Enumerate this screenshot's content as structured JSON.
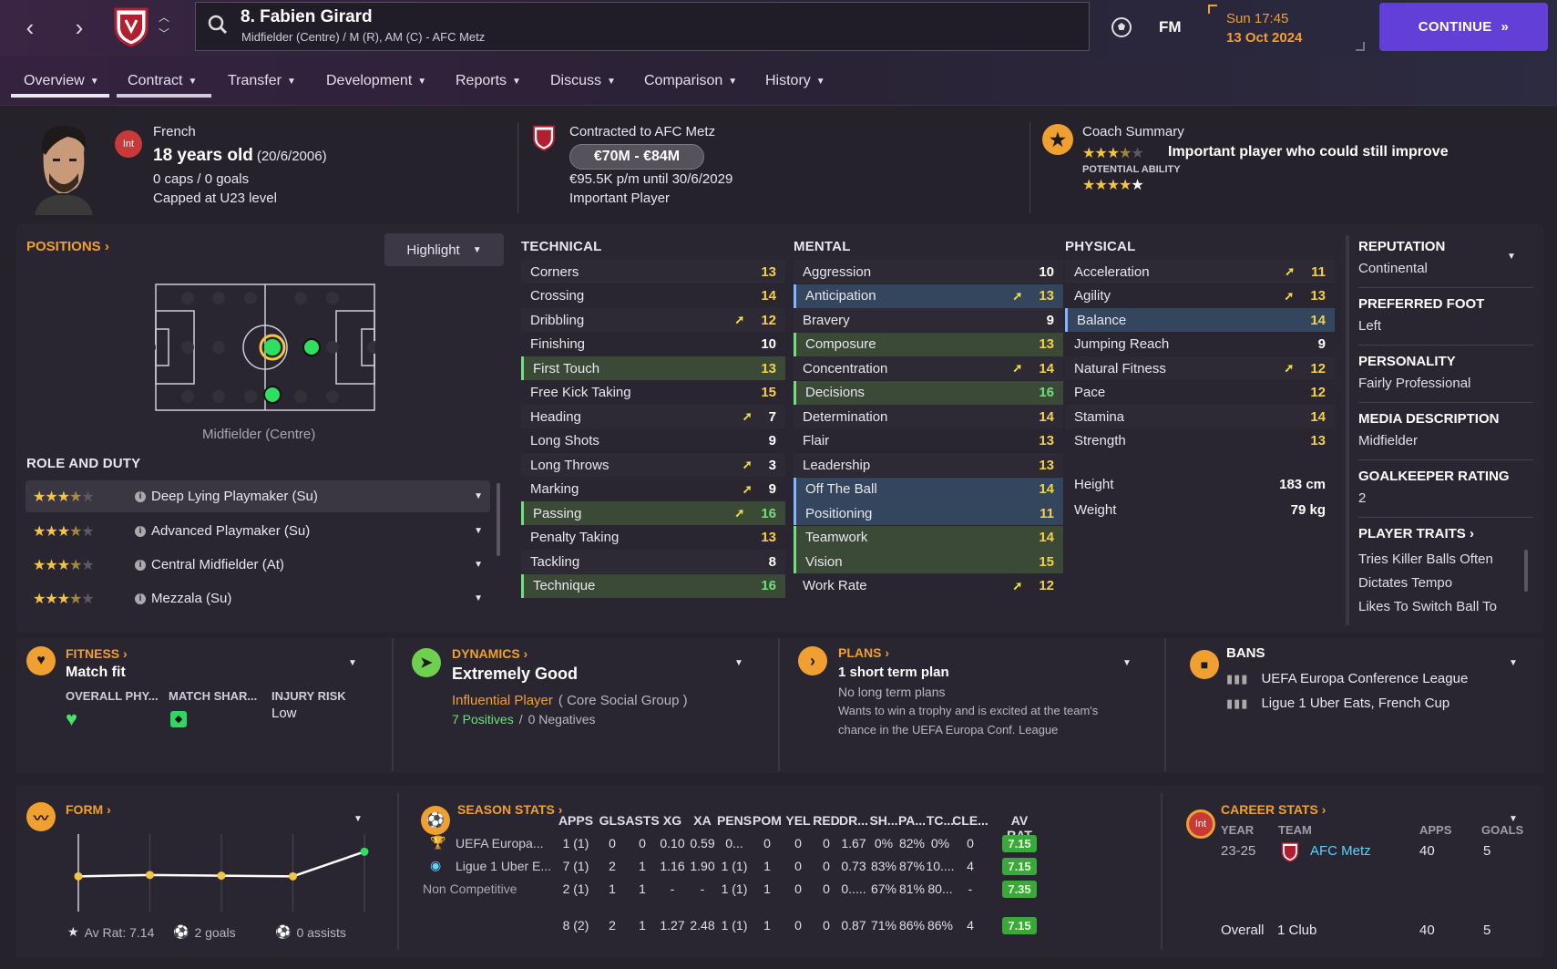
{
  "header": {
    "player_name": "8. Fabien Girard",
    "player_subtitle": "Midfielder (Centre) / M (R), AM (C) - AFC Metz",
    "brand": "FM",
    "time": "Sun 17:45",
    "date": "13 Oct 2024",
    "continue_label": "CONTINUE",
    "accent": "#6240d8"
  },
  "tabs": [
    {
      "label": "Overview",
      "active": true
    },
    {
      "label": "Contract",
      "active": false
    },
    {
      "label": "Transfer"
    },
    {
      "label": "Development"
    },
    {
      "label": "Reports"
    },
    {
      "label": "Discuss"
    },
    {
      "label": "Comparison"
    },
    {
      "label": "History"
    }
  ],
  "profile": {
    "nationality_badge": "Int",
    "nationality": "French",
    "age": "18 years old",
    "dob": "(20/6/2006)",
    "caps": "0 caps / 0 goals",
    "capped_level": "Capped at U23 level",
    "contracted_to": "Contracted to AFC Metz",
    "value": "€70M - €84M",
    "wage": "€95.5K p/m until 30/6/2029",
    "squad_status": "Important Player",
    "coach_summary_title": "Coach Summary",
    "coach_summary": "Important player who could still improve",
    "current_ability_stars": 3.5,
    "potential_label": "POTENTIAL ABILITY",
    "potential_ability_stars": 4.5
  },
  "positions": {
    "title": "POSITIONS",
    "highlight_label": "Highlight",
    "caption": "Midfielder (Centre)"
  },
  "roles": {
    "title": "ROLE AND DUTY",
    "items": [
      {
        "name": "Deep Lying Playmaker (Su)",
        "stars": 3.5
      },
      {
        "name": "Advanced Playmaker (Su)",
        "stars": 3.5
      },
      {
        "name": "Central Midfielder (At)",
        "stars": 3.5
      },
      {
        "name": "Mezzala (Su)",
        "stars": 3.5
      }
    ]
  },
  "attributes": {
    "technical_title": "TECHNICAL",
    "mental_title": "MENTAL",
    "physical_title": "PHYSICAL",
    "technical": [
      {
        "name": "Corners",
        "value": "13",
        "arrow": false,
        "hl": ""
      },
      {
        "name": "Crossing",
        "value": "14",
        "arrow": false,
        "hl": ""
      },
      {
        "name": "Dribbling",
        "value": "12",
        "arrow": true,
        "hl": ""
      },
      {
        "name": "Finishing",
        "value": "10",
        "arrow": false,
        "hl": ""
      },
      {
        "name": "First Touch",
        "value": "13",
        "arrow": false,
        "hl": "g"
      },
      {
        "name": "Free Kick Taking",
        "value": "15",
        "arrow": false,
        "hl": ""
      },
      {
        "name": "Heading",
        "value": "7",
        "arrow": true,
        "hl": ""
      },
      {
        "name": "Long Shots",
        "value": "9",
        "arrow": false,
        "hl": ""
      },
      {
        "name": "Long Throws",
        "value": "3",
        "arrow": true,
        "hl": ""
      },
      {
        "name": "Marking",
        "value": "9",
        "arrow": true,
        "hl": ""
      },
      {
        "name": "Passing",
        "value": "16",
        "arrow": true,
        "hl": "g"
      },
      {
        "name": "Penalty Taking",
        "value": "13",
        "arrow": false,
        "hl": ""
      },
      {
        "name": "Tackling",
        "value": "8",
        "arrow": false,
        "hl": ""
      },
      {
        "name": "Technique",
        "value": "16",
        "arrow": false,
        "hl": "g"
      }
    ],
    "mental": [
      {
        "name": "Aggression",
        "value": "10",
        "arrow": false,
        "hl": ""
      },
      {
        "name": "Anticipation",
        "value": "13",
        "arrow": true,
        "hl": "b"
      },
      {
        "name": "Bravery",
        "value": "9",
        "arrow": false,
        "hl": ""
      },
      {
        "name": "Composure",
        "value": "13",
        "arrow": false,
        "hl": "g"
      },
      {
        "name": "Concentration",
        "value": "14",
        "arrow": true,
        "hl": ""
      },
      {
        "name": "Decisions",
        "value": "16",
        "arrow": false,
        "hl": "g"
      },
      {
        "name": "Determination",
        "value": "14",
        "arrow": false,
        "hl": ""
      },
      {
        "name": "Flair",
        "value": "13",
        "arrow": false,
        "hl": ""
      },
      {
        "name": "Leadership",
        "value": "13",
        "arrow": false,
        "hl": ""
      },
      {
        "name": "Off The Ball",
        "value": "14",
        "arrow": false,
        "hl": "b"
      },
      {
        "name": "Positioning",
        "value": "11",
        "arrow": false,
        "hl": "b"
      },
      {
        "name": "Teamwork",
        "value": "14",
        "arrow": false,
        "hl": "g"
      },
      {
        "name": "Vision",
        "value": "15",
        "arrow": false,
        "hl": "g"
      },
      {
        "name": "Work Rate",
        "value": "12",
        "arrow": true,
        "hl": ""
      }
    ],
    "physical": [
      {
        "name": "Acceleration",
        "value": "11",
        "arrow": true,
        "hl": ""
      },
      {
        "name": "Agility",
        "value": "13",
        "arrow": true,
        "hl": ""
      },
      {
        "name": "Balance",
        "value": "14",
        "arrow": false,
        "hl": "b"
      },
      {
        "name": "Jumping Reach",
        "value": "9",
        "arrow": false,
        "hl": ""
      },
      {
        "name": "Natural Fitness",
        "value": "12",
        "arrow": true,
        "hl": ""
      },
      {
        "name": "Pace",
        "value": "12",
        "arrow": false,
        "hl": ""
      },
      {
        "name": "Stamina",
        "value": "14",
        "arrow": false,
        "hl": ""
      },
      {
        "name": "Strength",
        "value": "13",
        "arrow": false,
        "hl": ""
      }
    ],
    "height_label": "Height",
    "height": "183 cm",
    "weight_label": "Weight",
    "weight": "79 kg"
  },
  "side": {
    "reputation_h": "REPUTATION",
    "reputation": "Continental",
    "foot_h": "PREFERRED FOOT",
    "foot": "Left",
    "personality_h": "PERSONALITY",
    "personality": "Fairly Professional",
    "media_h": "MEDIA DESCRIPTION",
    "media": "Midfielder",
    "gk_h": "GOALKEEPER RATING",
    "gk": "2",
    "traits_h": "PLAYER TRAITS",
    "traits": [
      "Tries Killer Balls Often",
      "Dictates Tempo",
      "Likes To Switch Ball To"
    ]
  },
  "fitness": {
    "title": "FITNESS",
    "status": "Match fit",
    "col1": "OVERALL PHY...",
    "col2": "MATCH SHAR...",
    "col3": "INJURY RISK",
    "injury": "Low"
  },
  "dynamics": {
    "title": "DYNAMICS",
    "status": "Extremely Good",
    "role": "Influential Player",
    "group": "( Core Social Group )",
    "positives": "7 Positives",
    "sep": "/",
    "negatives": "0 Negatives"
  },
  "plans": {
    "title": "PLANS",
    "status": "1 short term plan",
    "line1": "No long term plans",
    "line2": "Wants to win a trophy and is excited at the team's",
    "line3": "chance in the UEFA Europa Conf. League"
  },
  "bans": {
    "title": "BANS",
    "items": [
      "UEFA Europa Conference League",
      "Ligue 1 Uber Eats, French Cup"
    ]
  },
  "form": {
    "title": "FORM",
    "ratings": [
      7.0,
      7.02,
      7.01,
      7.0,
      7.35
    ],
    "av_rat": "Av Rat: 7.14",
    "goals": "2 goals",
    "assists": "0 assists"
  },
  "season_stats": {
    "title": "SEASON STATS",
    "headers": [
      "APPS",
      "GLS",
      "ASTS",
      "XG",
      "XA",
      "PENS",
      "POM",
      "YEL",
      "RED",
      "DR...",
      "SH...",
      "PA...",
      "TC...",
      "CLE...",
      "AV RAT"
    ],
    "rows": [
      {
        "comp": "UEFA Europa...",
        "cells": [
          "1 (1)",
          "0",
          "0",
          "0.10",
          "0.59",
          "0...",
          "0",
          "0",
          "0",
          "1.67",
          "0%",
          "82%",
          "0%",
          "0",
          "7.15"
        ]
      },
      {
        "comp": "Ligue 1 Uber E...",
        "cells": [
          "7 (1)",
          "2",
          "1",
          "1.16",
          "1.90",
          "1 (1)",
          "1",
          "0",
          "0",
          "0.73",
          "83%",
          "87%",
          "10....",
          "4",
          "7.15"
        ]
      },
      {
        "comp": "Non Competitive",
        "cells": [
          "2 (1)",
          "1",
          "1",
          "-",
          "-",
          "1 (1)",
          "1",
          "0",
          "0",
          "0.....",
          "67%",
          "81%",
          "80...",
          "-",
          "7.35"
        ]
      }
    ],
    "total": [
      "8 (2)",
      "2",
      "1",
      "1.27",
      "2.48",
      "1 (1)",
      "1",
      "0",
      "0",
      "0.87",
      "71%",
      "86%",
      "86%",
      "4",
      "7.15"
    ]
  },
  "career_stats": {
    "title": "CAREER STATS",
    "badge": "Int",
    "h_year": "YEAR",
    "h_team": "TEAM",
    "h_apps": "APPS",
    "h_goals": "GOALS",
    "year": "23-25",
    "team": "AFC Metz",
    "apps": "40",
    "goals": "5",
    "overall": "Overall",
    "clubs": "1 Club",
    "total_apps": "40",
    "total_goals": "5"
  }
}
